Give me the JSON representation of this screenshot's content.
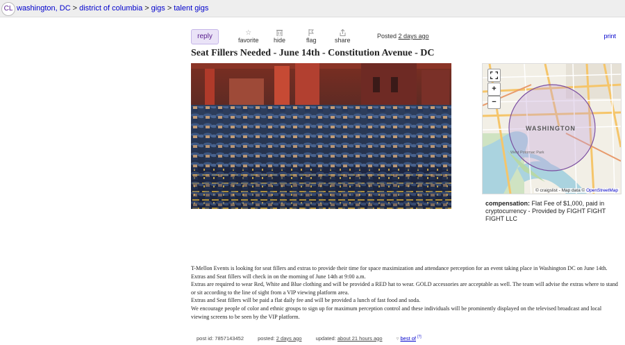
{
  "header": {
    "logo": "CL",
    "breadcrumbs": [
      "washington, DC",
      "district of columbia",
      "gigs",
      "talent gigs"
    ]
  },
  "toolbar": {
    "reply": "reply",
    "favorite": "favorite",
    "hide": "hide",
    "flag": "flag",
    "share": "share",
    "posted_label": "Posted",
    "posted_time": "2 days ago",
    "print": "print"
  },
  "post": {
    "title": "Seat Fillers Needed - June 14th - Constitution Avenue - DC",
    "compensation_label": "compensation:",
    "compensation_value": "Flat Fee of $1,000, paid in cryptocurrency - Provided by FIGHT FIGHT FIGHT LLC",
    "body": [
      "T-Mellon Events is looking for seat fillers and extras to provide their time for space maximization and attendance perception for an event taking place in Washington DC on June 14th. Extras and Seat fillers will check in on the morning of June 14th at 9:00 a.m.",
      "Extras are required to wear Red, White and Blue clothing and will be provided a RED hat to wear. GOLD accessories are acceptable as well. The team will advise the extras where to stand or sit according to the line of sight from a VIP viewing platform area.",
      "Extras and Seat fillers will be paid a flat daily fee and will be provided a lunch of fast food and soda.",
      "We encourage people of color and ethnic groups to sign up for maximum perception control and these individuals will be prominently displayed on the televised broadcast and local viewing screens to be seen by the VIP platform."
    ]
  },
  "map": {
    "label": "WASHINGTON",
    "sublabel": "West Potomac Park",
    "attribution_prefix": "© craigslist - Map data ©",
    "attribution_link": "OpenStreetMap"
  },
  "footer": {
    "post_id_label": "post id:",
    "post_id": "7857143452",
    "posted_label": "posted:",
    "posted": "2 days ago",
    "updated_label": "updated:",
    "updated": "about 21 hours ago",
    "best_of": "best of",
    "best_of_sup": "[?]"
  },
  "colors": {
    "link": "#0000cc",
    "reply_bg": "#eae3f7",
    "reply_text": "#551a8b"
  }
}
